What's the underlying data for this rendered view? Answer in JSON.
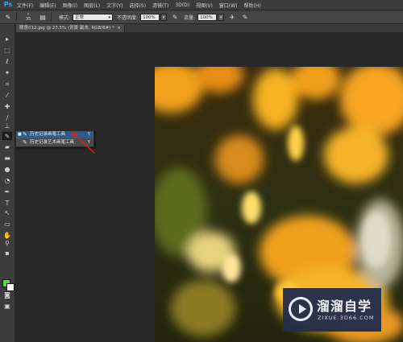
{
  "app": {
    "logo": "Ps"
  },
  "menu": [
    "文件(F)",
    "编辑(E)",
    "图像(I)",
    "图层(L)",
    "文字(Y)",
    "选择(S)",
    "滤镜(T)",
    "3D(D)",
    "视图(V)",
    "窗口(W)",
    "帮助(H)"
  ],
  "options": {
    "brush_size": "35",
    "mode_label": "模式:",
    "mode_value": "正常",
    "opacity_label": "不透明度:",
    "opacity_value": "100%",
    "flow_label": "流量:",
    "flow_value": "100%"
  },
  "document": {
    "tab_title": "随意012.jpg @ 27.5% (背景 副本, RGB/8#) *"
  },
  "flyout": {
    "items": [
      {
        "label": "历史记录画笔工具",
        "shortcut": "Y",
        "selected": true,
        "icon": "history-brush-icon"
      },
      {
        "label": "历史记录艺术画笔工具",
        "shortcut": "Y",
        "selected": false,
        "icon": "art-history-brush-icon"
      }
    ]
  },
  "colors": {
    "foreground": "#5ad64a",
    "background": "#ffffff",
    "accent": "#31a8ff"
  },
  "watermark": {
    "title": "溜溜自学",
    "url": "ZIXUE.3D66.COM"
  }
}
